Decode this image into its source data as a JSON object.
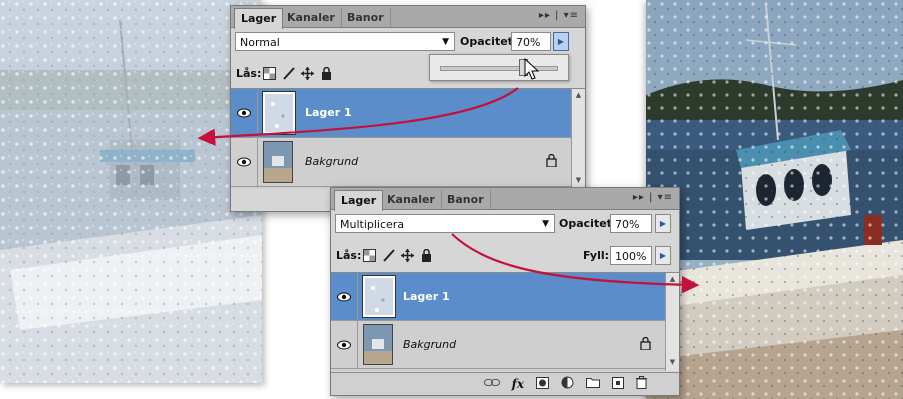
{
  "colors": {
    "accent_arrow": "#c4103c",
    "selected_layer": "#5b8dcb",
    "panel_bg": "#d6d6d6",
    "tabbar_bg": "#a9a9a9"
  },
  "panel_top": {
    "tabs": [
      "Lager",
      "Kanaler",
      "Banor"
    ],
    "active_tab": "Lager",
    "menu_glyph": "▸▸ | ▾≡",
    "blend_mode": "Normal",
    "opacity_label": "Opacitet:",
    "opacity_value": "70%",
    "opacity_slider_fraction": 0.7,
    "lock_label": "Lås:",
    "layers": [
      {
        "name": "Lager 1",
        "selected": true
      },
      {
        "name": "Bakgrund",
        "selected": false,
        "locked": true
      }
    ]
  },
  "panel_bottom": {
    "tabs": [
      "Lager",
      "Kanaler",
      "Banor"
    ],
    "active_tab": "Lager",
    "menu_glyph": "▸▸ | ▾≡",
    "blend_mode": "Multiplicera",
    "opacity_label": "Opacitet:",
    "opacity_value": "70%",
    "lock_label": "Lås:",
    "fill_label": "Fyll:",
    "fill_value": "100%",
    "layers": [
      {
        "name": "Lager 1",
        "selected": true
      },
      {
        "name": "Bakgrund",
        "selected": false,
        "locked": true
      }
    ],
    "bottom_icons": [
      "link-icon",
      "fx-icon",
      "mask-icon",
      "adjustment-icon",
      "folder-icon",
      "new-layer-icon",
      "trash-icon"
    ],
    "fx_glyph": "fx"
  }
}
